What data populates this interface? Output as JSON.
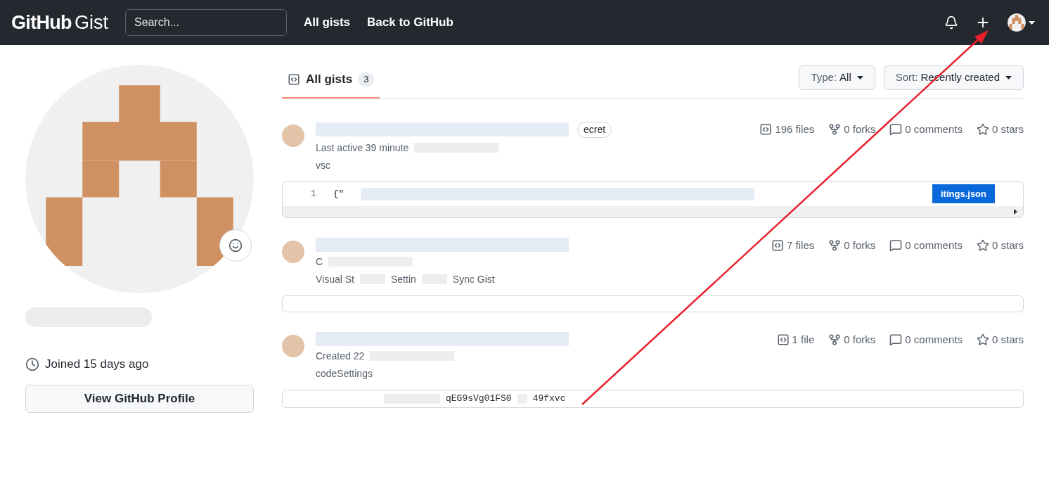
{
  "header": {
    "logo_bold": "GitHub",
    "logo_light": "Gist",
    "search": {
      "placeholder": "Search..."
    },
    "nav": [
      "All gists",
      "Back to GitHub"
    ]
  },
  "profile": {
    "joined": "Joined 15 days ago",
    "profile_button": "View GitHub Profile"
  },
  "tabs": [
    {
      "label": "All gists",
      "count": "3",
      "selected": true
    }
  ],
  "filters": [
    {
      "label": "Type:",
      "value": "All"
    },
    {
      "label": "Sort:",
      "value": "Recently created"
    }
  ],
  "gists": [
    {
      "badge": "ecret",
      "meta": "Last active 39 minute",
      "description_parts": [
        "vsc"
      ],
      "preview": {
        "kind": "code",
        "line_number": "1",
        "code": "{\"",
        "file_tab": "itings.json"
      },
      "stats": [
        "196 files",
        "0 forks",
        "0 comments",
        "0 stars"
      ]
    },
    {
      "meta": "C",
      "description_parts": [
        "Visual St",
        "Settin",
        "Sync Gist"
      ],
      "preview": {
        "kind": "empty"
      },
      "stats": [
        "7 files",
        "0 forks",
        "0 comments",
        "0 stars"
      ]
    },
    {
      "meta": "Created 22",
      "description_parts": [
        "codeSettings"
      ],
      "preview": {
        "kind": "token",
        "code_parts": [
          "qEG9sVg01FS0",
          "49fxvc"
        ]
      },
      "stats": [
        "1 file",
        "0 forks",
        "0 comments",
        "0 stars"
      ]
    }
  ]
}
